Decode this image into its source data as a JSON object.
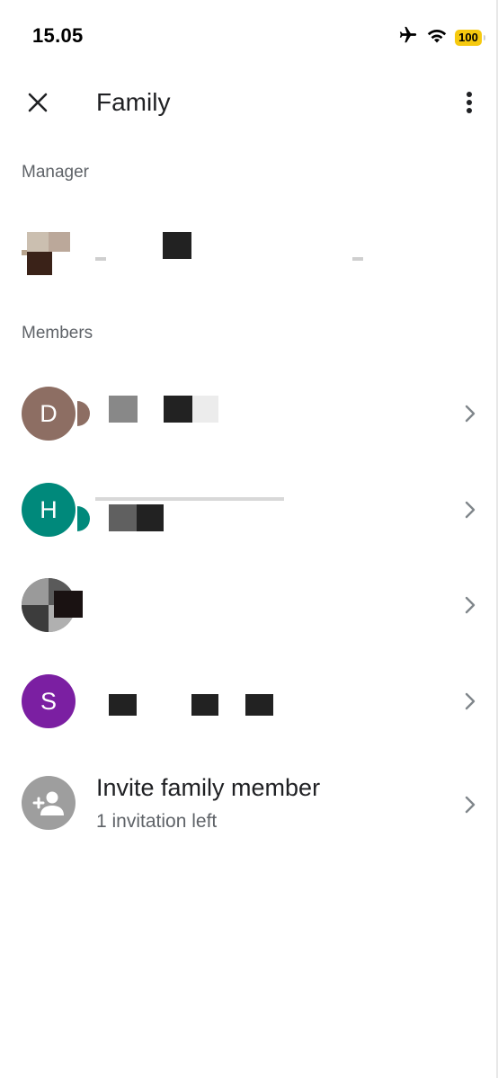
{
  "status_bar": {
    "time": "15.05",
    "battery": "100",
    "icons": [
      "airplane-icon",
      "wifi-icon",
      "battery-icon"
    ]
  },
  "header": {
    "title": "Family",
    "icons": [
      "close-icon",
      "more-vert-icon"
    ]
  },
  "sections": {
    "manager_label": "Manager",
    "members_label": "Members"
  },
  "members": [
    {
      "initial": "D",
      "color": "#8d6e63"
    },
    {
      "initial": "H",
      "color": "#00897b"
    },
    {
      "initial": "",
      "color": "#9e9e9e"
    },
    {
      "initial": "S",
      "color": "#7b1fa2"
    }
  ],
  "invite": {
    "title": "Invite family member",
    "subtitle": "1 invitation left",
    "icon": "add-person-icon",
    "icon_bg": "#9e9e9e"
  }
}
